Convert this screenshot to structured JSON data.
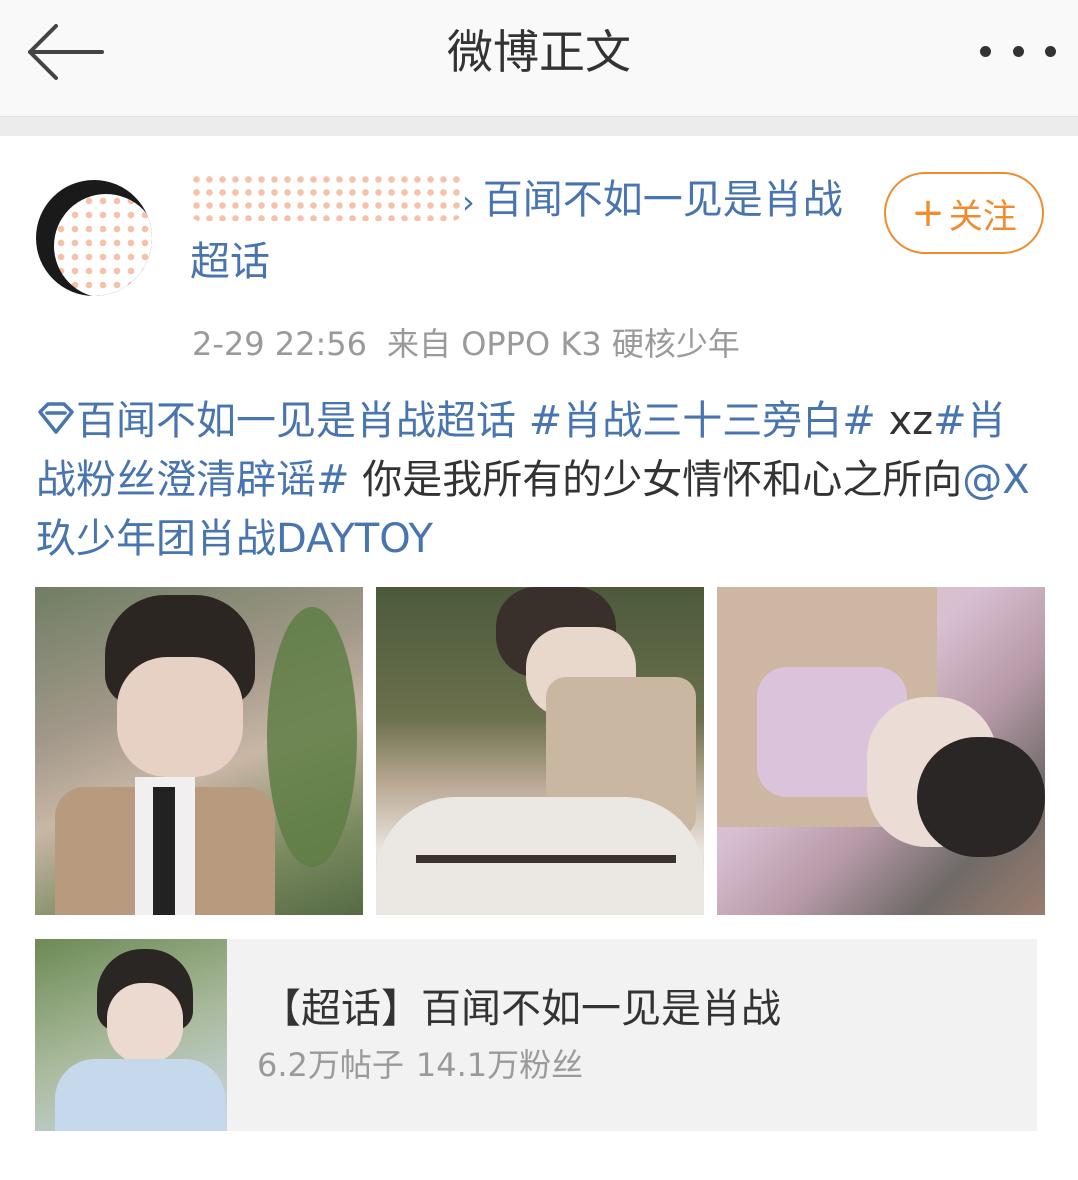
{
  "navbar": {
    "title": "微博正文",
    "back_icon": "back-arrow-icon",
    "more_icon": "more-dots-icon"
  },
  "post": {
    "author_suffix": "百闻不如一见是肖战超话",
    "follow_label": "关注",
    "follow_color": "#f08c2d",
    "timestamp": "2-29 22:56",
    "source": "来自 OPPO K3 硬核少年",
    "link_color": "#4874b0",
    "text": {
      "supertopic": "百闻不如一见是肖战超话",
      "tag1": "#肖战三十三旁白#",
      "plain1": " xz",
      "tag2": "#肖战粉丝澄清辟谣#",
      "plain2": " 你是我所有的少女情怀和心之所向",
      "mention": "@X玖少年团肖战DAYTOY"
    },
    "images": [
      "photo-1",
      "photo-2",
      "photo-3"
    ]
  },
  "topic_card": {
    "title": "【超话】百闻不如一见是肖战",
    "posts": "6.2万帖子",
    "fans": "14.1万粉丝"
  }
}
